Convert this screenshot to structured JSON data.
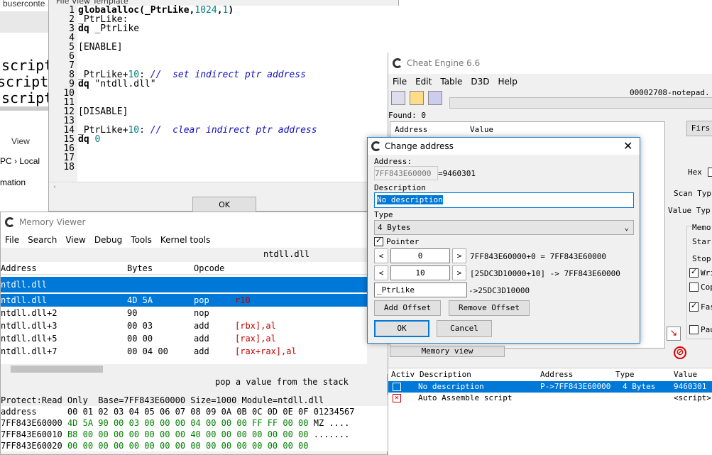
{
  "background": {
    "crumb": "buserconte",
    "menu_partial": "File    View    Template",
    "script_lines": [
      "script",
      "script:",
      "script"
    ],
    "view_label": "View",
    "pc_crumb": "PC",
    "local_crumb": "Local",
    "mation": "mation"
  },
  "editor": {
    "line_numbers": [
      "1",
      "2",
      "3",
      "4",
      "5",
      "6",
      "7",
      "8",
      "9",
      "10",
      "11",
      "12",
      "13",
      "14",
      "15",
      "16",
      "17",
      "18"
    ],
    "lines": [
      [
        {
          "t": "globalalloc",
          "c": "kw"
        },
        {
          "t": "(_PtrLike,",
          "c": "kw"
        },
        {
          "t": "1024",
          "c": "num"
        },
        {
          "t": ",",
          "c": "kw"
        },
        {
          "t": "1",
          "c": "num"
        },
        {
          "t": ")",
          "c": "kw"
        }
      ],
      [
        {
          "t": "_PtrLike:",
          "c": ""
        }
      ],
      [
        {
          "t": "dq",
          "c": "kw"
        },
        {
          "t": " _PtrLike",
          "c": ""
        }
      ],
      [],
      [
        {
          "t": "[ENABLE]",
          "c": ""
        }
      ],
      [],
      [],
      [
        {
          "t": "_PtrLike+",
          "c": ""
        },
        {
          "t": "10",
          "c": "num"
        },
        {
          "t": ": ",
          "c": ""
        },
        {
          "t": "//  set indirect ptr address",
          "c": "cmt"
        }
      ],
      [
        {
          "t": "dq",
          "c": "kw"
        },
        {
          "t": " \"ntdll.dll\"",
          "c": ""
        }
      ],
      [],
      [],
      [
        {
          "t": "[DISABLE]",
          "c": ""
        }
      ],
      [],
      [
        {
          "t": "_PtrLike+",
          "c": ""
        },
        {
          "t": "10",
          "c": "num"
        },
        {
          "t": ": ",
          "c": ""
        },
        {
          "t": "//  clear indirect ptr address",
          "c": "cmt"
        }
      ],
      [
        {
          "t": "dq",
          "c": "kw"
        },
        {
          "t": " ",
          "c": ""
        },
        {
          "t": "0",
          "c": "num"
        }
      ],
      [],
      [],
      []
    ],
    "ok_label": "OK"
  },
  "memory_viewer": {
    "title": "Memory Viewer",
    "menu": [
      "File",
      "Search",
      "View",
      "Debug",
      "Tools",
      "Kernel tools"
    ],
    "module_label": "ntdll.dll",
    "columns": [
      "Address",
      "Bytes",
      "Opcode"
    ],
    "group_label": "ntdll.dll",
    "rows": [
      {
        "address": "ntdll.dll",
        "bytes": "4D 5A",
        "opcode": "pop",
        "operand": "r10",
        "selected": true
      },
      {
        "address": "ntdll.dll+2",
        "bytes": "90",
        "opcode": "nop",
        "operand": "",
        "selected": false
      },
      {
        "address": "ntdll.dll+3",
        "bytes": "00 03",
        "opcode": "add",
        "operand": "[rbx],al",
        "selected": false
      },
      {
        "address": "ntdll.dll+5",
        "bytes": "00 00",
        "opcode": "add",
        "operand": "[rax],al",
        "selected": false
      },
      {
        "address": "ntdll.dll+7",
        "bytes": "00 04 00",
        "opcode": "add",
        "operand": "[rax+rax],al",
        "selected": false
      }
    ],
    "status_text": "pop a value from the stack",
    "protect_line": "Protect:Read Only  Base=7FF843E60000 Size=1000 Module=ntdll.dll",
    "hex_header": "address      00 01 02 03 04 05 06 07 08 09 0A 0B 0C 0D 0E 0F 01234567",
    "hex_rows": [
      {
        "addr": "7FF843E60000",
        "bytes": "4D 5A 90 00 03 00 00 00 04 00 00 00 FF FF 00 00",
        "ascii": "MZ ...."
      },
      {
        "addr": "7FF843E60010",
        "bytes": "B8 00 00 00 00 00 00 00 40 00 00 00 00 00 00 00",
        "ascii": "......."
      },
      {
        "addr": "7FF843E60020",
        "bytes": "00 00 00 00 00 00 00 00 00 00 00 00 00 00 00 00",
        "ascii": ""
      }
    ]
  },
  "cheat_engine": {
    "title": "Cheat Engine 6.6",
    "menu": [
      "File",
      "Edit",
      "Table",
      "D3D",
      "Help"
    ],
    "process": "00002708-notepad.",
    "found": "Found: 0",
    "list_columns": [
      "Address",
      "Value"
    ],
    "first_scan": "Firs",
    "hex_label": "Hex",
    "scan_type": "Scan Typ",
    "value_type": "Value Typ",
    "memo": "Memo",
    "start": "Star",
    "stop": "Stop",
    "writable": "Wri",
    "copy": "Cop",
    "fast": "Fas",
    "pause": "Pau",
    "memory_view_btn": "Memory view",
    "table_columns": [
      "Activ",
      "Description",
      "Address",
      "Type",
      "Value"
    ],
    "table_rows": [
      {
        "description": "No description",
        "address": "P->7FF843E60000",
        "type": "4 Bytes",
        "value": "9460301",
        "selected": true
      },
      {
        "description": "Auto Assemble script",
        "address": "",
        "type": "",
        "value": "<script>",
        "selected": false
      }
    ]
  },
  "dialog": {
    "title": "Change address",
    "address_label": "Address:",
    "address_value": "7FF843E60000",
    "address_result": "=9460301",
    "description_label": "Description",
    "description_value": "No description",
    "type_label": "Type",
    "type_value": "4 Bytes",
    "pointer_label": "Pointer",
    "offset1": "0",
    "offset1_result": "7FF843E60000+0 = 7FF843E60000",
    "offset2": "10",
    "offset2_result": "[25DC3D10000+10] -> 7FF843E60000",
    "base_value": "_PtrLike",
    "base_result": "->25DC3D10000",
    "add_offset": "Add Offset",
    "remove_offset": "Remove Offset",
    "ok": "OK",
    "cancel": "Cancel",
    "lt": "<",
    "gt": ">"
  }
}
